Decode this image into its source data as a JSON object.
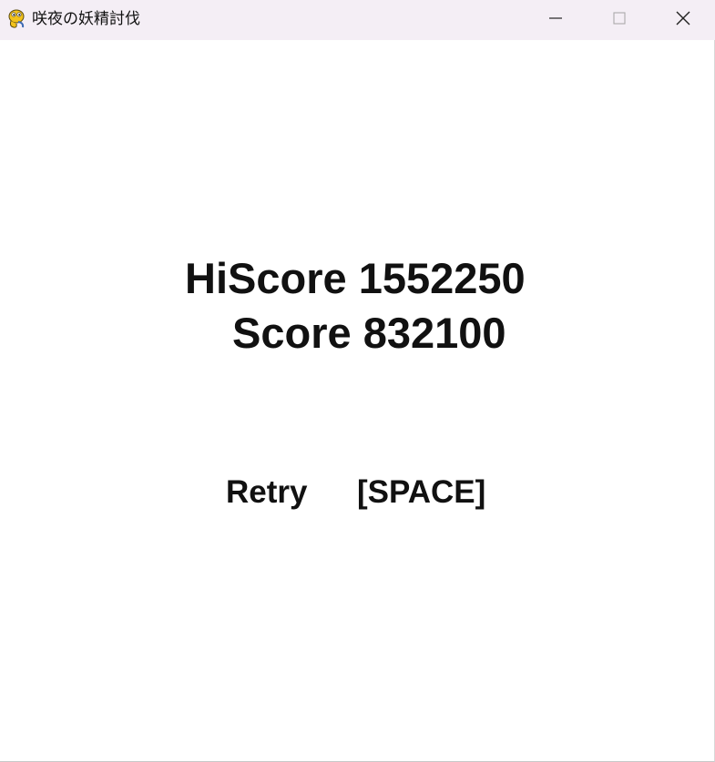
{
  "window": {
    "title": "咲夜の妖精討伐",
    "app_icon": "pygame-snake-icon",
    "controls": {
      "minimize_icon": "minimize-icon",
      "maximize_icon": "maximize-icon",
      "close_icon": "close-icon"
    }
  },
  "game_over": {
    "hiscore_label": "HiScore",
    "hiscore_value": "1552250",
    "score_label": "Score",
    "score_value": "832100",
    "retry_label": "Retry",
    "retry_key": "[SPACE]"
  },
  "colors": {
    "titlebar_bg": "#f4eef5",
    "background": "#ffffff",
    "text": "#111111"
  }
}
